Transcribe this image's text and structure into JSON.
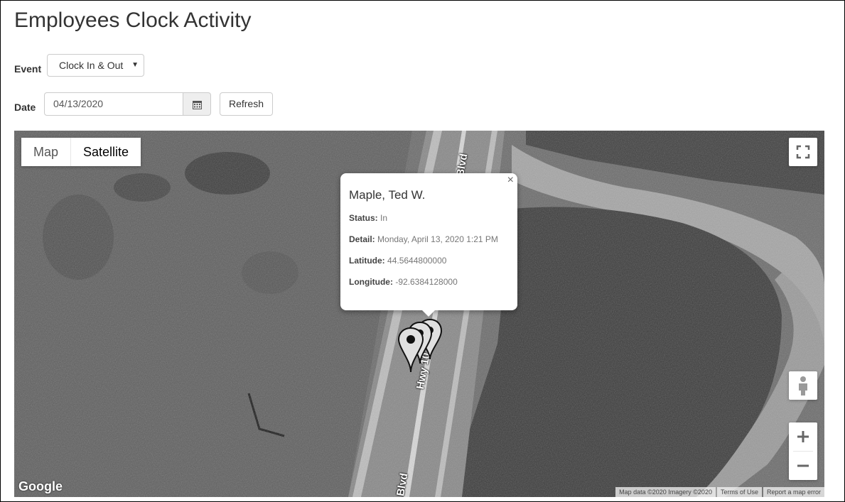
{
  "page": {
    "title": "Employees Clock Activity"
  },
  "filters": {
    "event_label": "Event",
    "event_value": "Clock In & Out",
    "date_label": "Date",
    "date_value": "04/13/2020",
    "refresh_label": "Refresh"
  },
  "map": {
    "type_map_label": "Map",
    "type_satellite_label": "Satellite",
    "selected_type": "Satellite",
    "logo": "Google",
    "attribution": {
      "data": "Map data ©2020 Imagery ©2020",
      "terms": "Terms of Use",
      "report": "Report a map error"
    },
    "road_labels": [
      "Hwy 10",
      "Blvd",
      "Blvd"
    ],
    "icons": {
      "fullscreen": "fullscreen-icon",
      "pegman": "pegman-icon",
      "zoom_in": "plus-icon",
      "zoom_out": "minus-icon",
      "calendar": "calendar-icon",
      "marker": "map-pin-icon"
    }
  },
  "info_window": {
    "close_glyph": "×",
    "name": "Maple, Ted W.",
    "status_label": "Status:",
    "status_value": "In",
    "detail_label": "Detail:",
    "detail_value": "Monday, April 13, 2020 1:21 PM",
    "latitude_label": "Latitude:",
    "latitude_value": "44.5644800000",
    "longitude_label": "Longitude:",
    "longitude_value": "-92.6384128000"
  }
}
